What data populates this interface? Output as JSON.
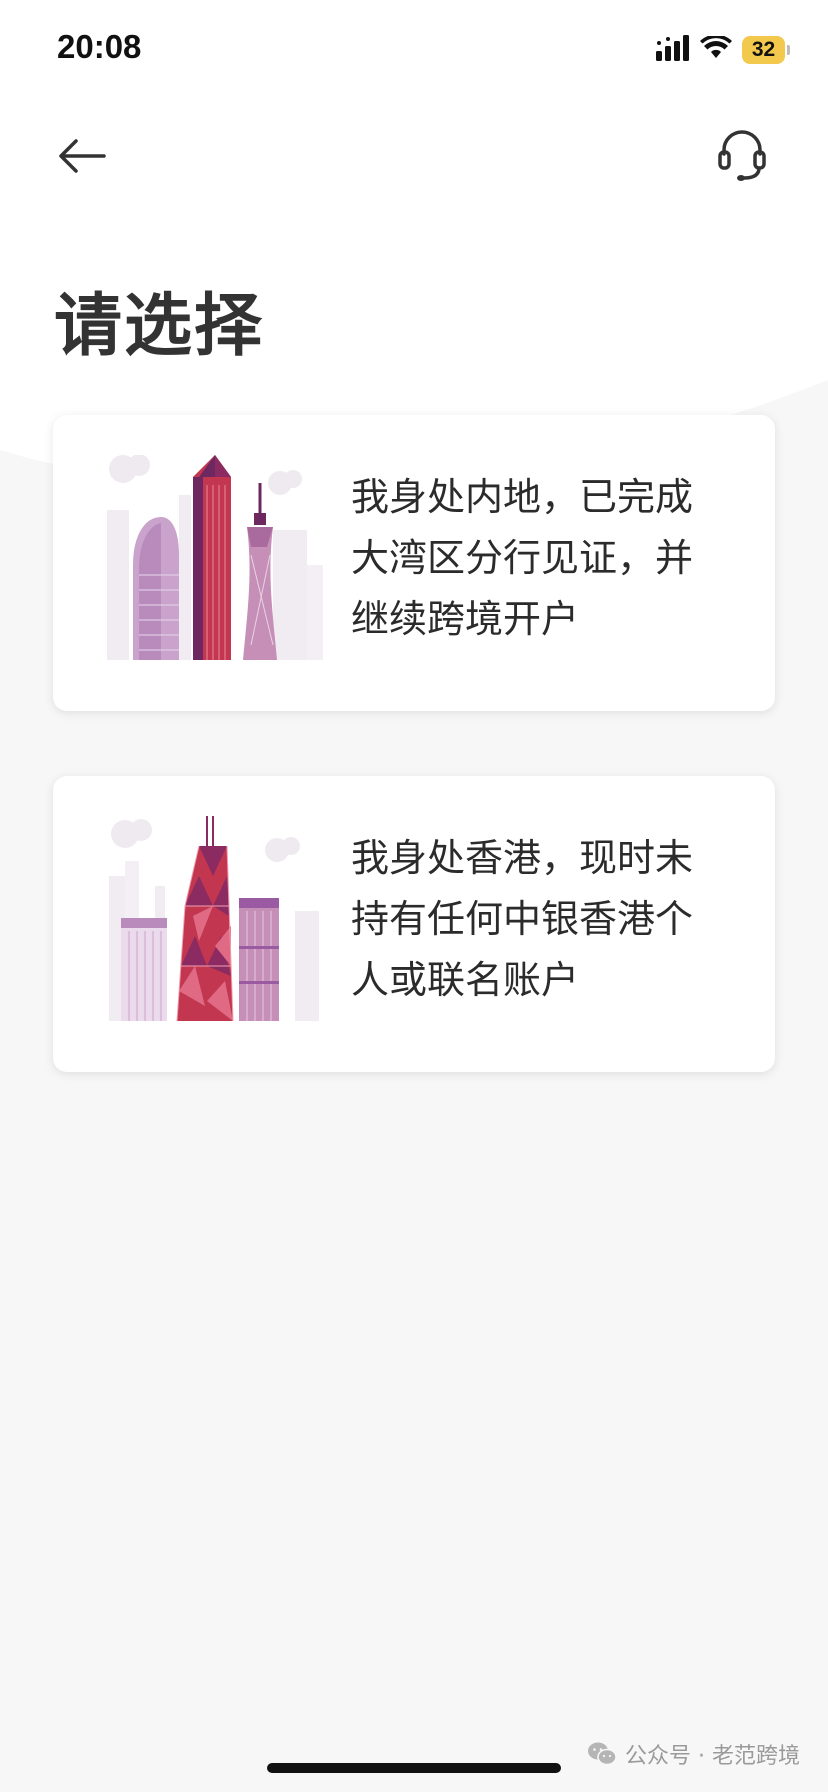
{
  "status_bar": {
    "time": "20:08",
    "battery": "32",
    "icons": [
      "signal-icon",
      "wifi-icon",
      "battery-icon"
    ]
  },
  "nav": {
    "back_icon": "arrow-left-icon",
    "support_icon": "headset-icon"
  },
  "page": {
    "title": "请选择"
  },
  "options": [
    {
      "lines": [
        "我身处内地，已完成",
        "大湾区分行见证，并",
        "继续跨境开户"
      ],
      "illustration": "guangzhou-skyline"
    },
    {
      "lines": [
        "我身处香港，现时未",
        "持有任何中银香港个",
        "人或联名账户"
      ],
      "illustration": "hongkong-skyline"
    }
  ],
  "watermark": {
    "text": "公众号 · 老范跨境"
  },
  "colors": {
    "accent_red": "#c2364f",
    "accent_purple": "#9b5ba3",
    "battery_yellow": "#f2c94c",
    "background": "#f7f7f7"
  }
}
